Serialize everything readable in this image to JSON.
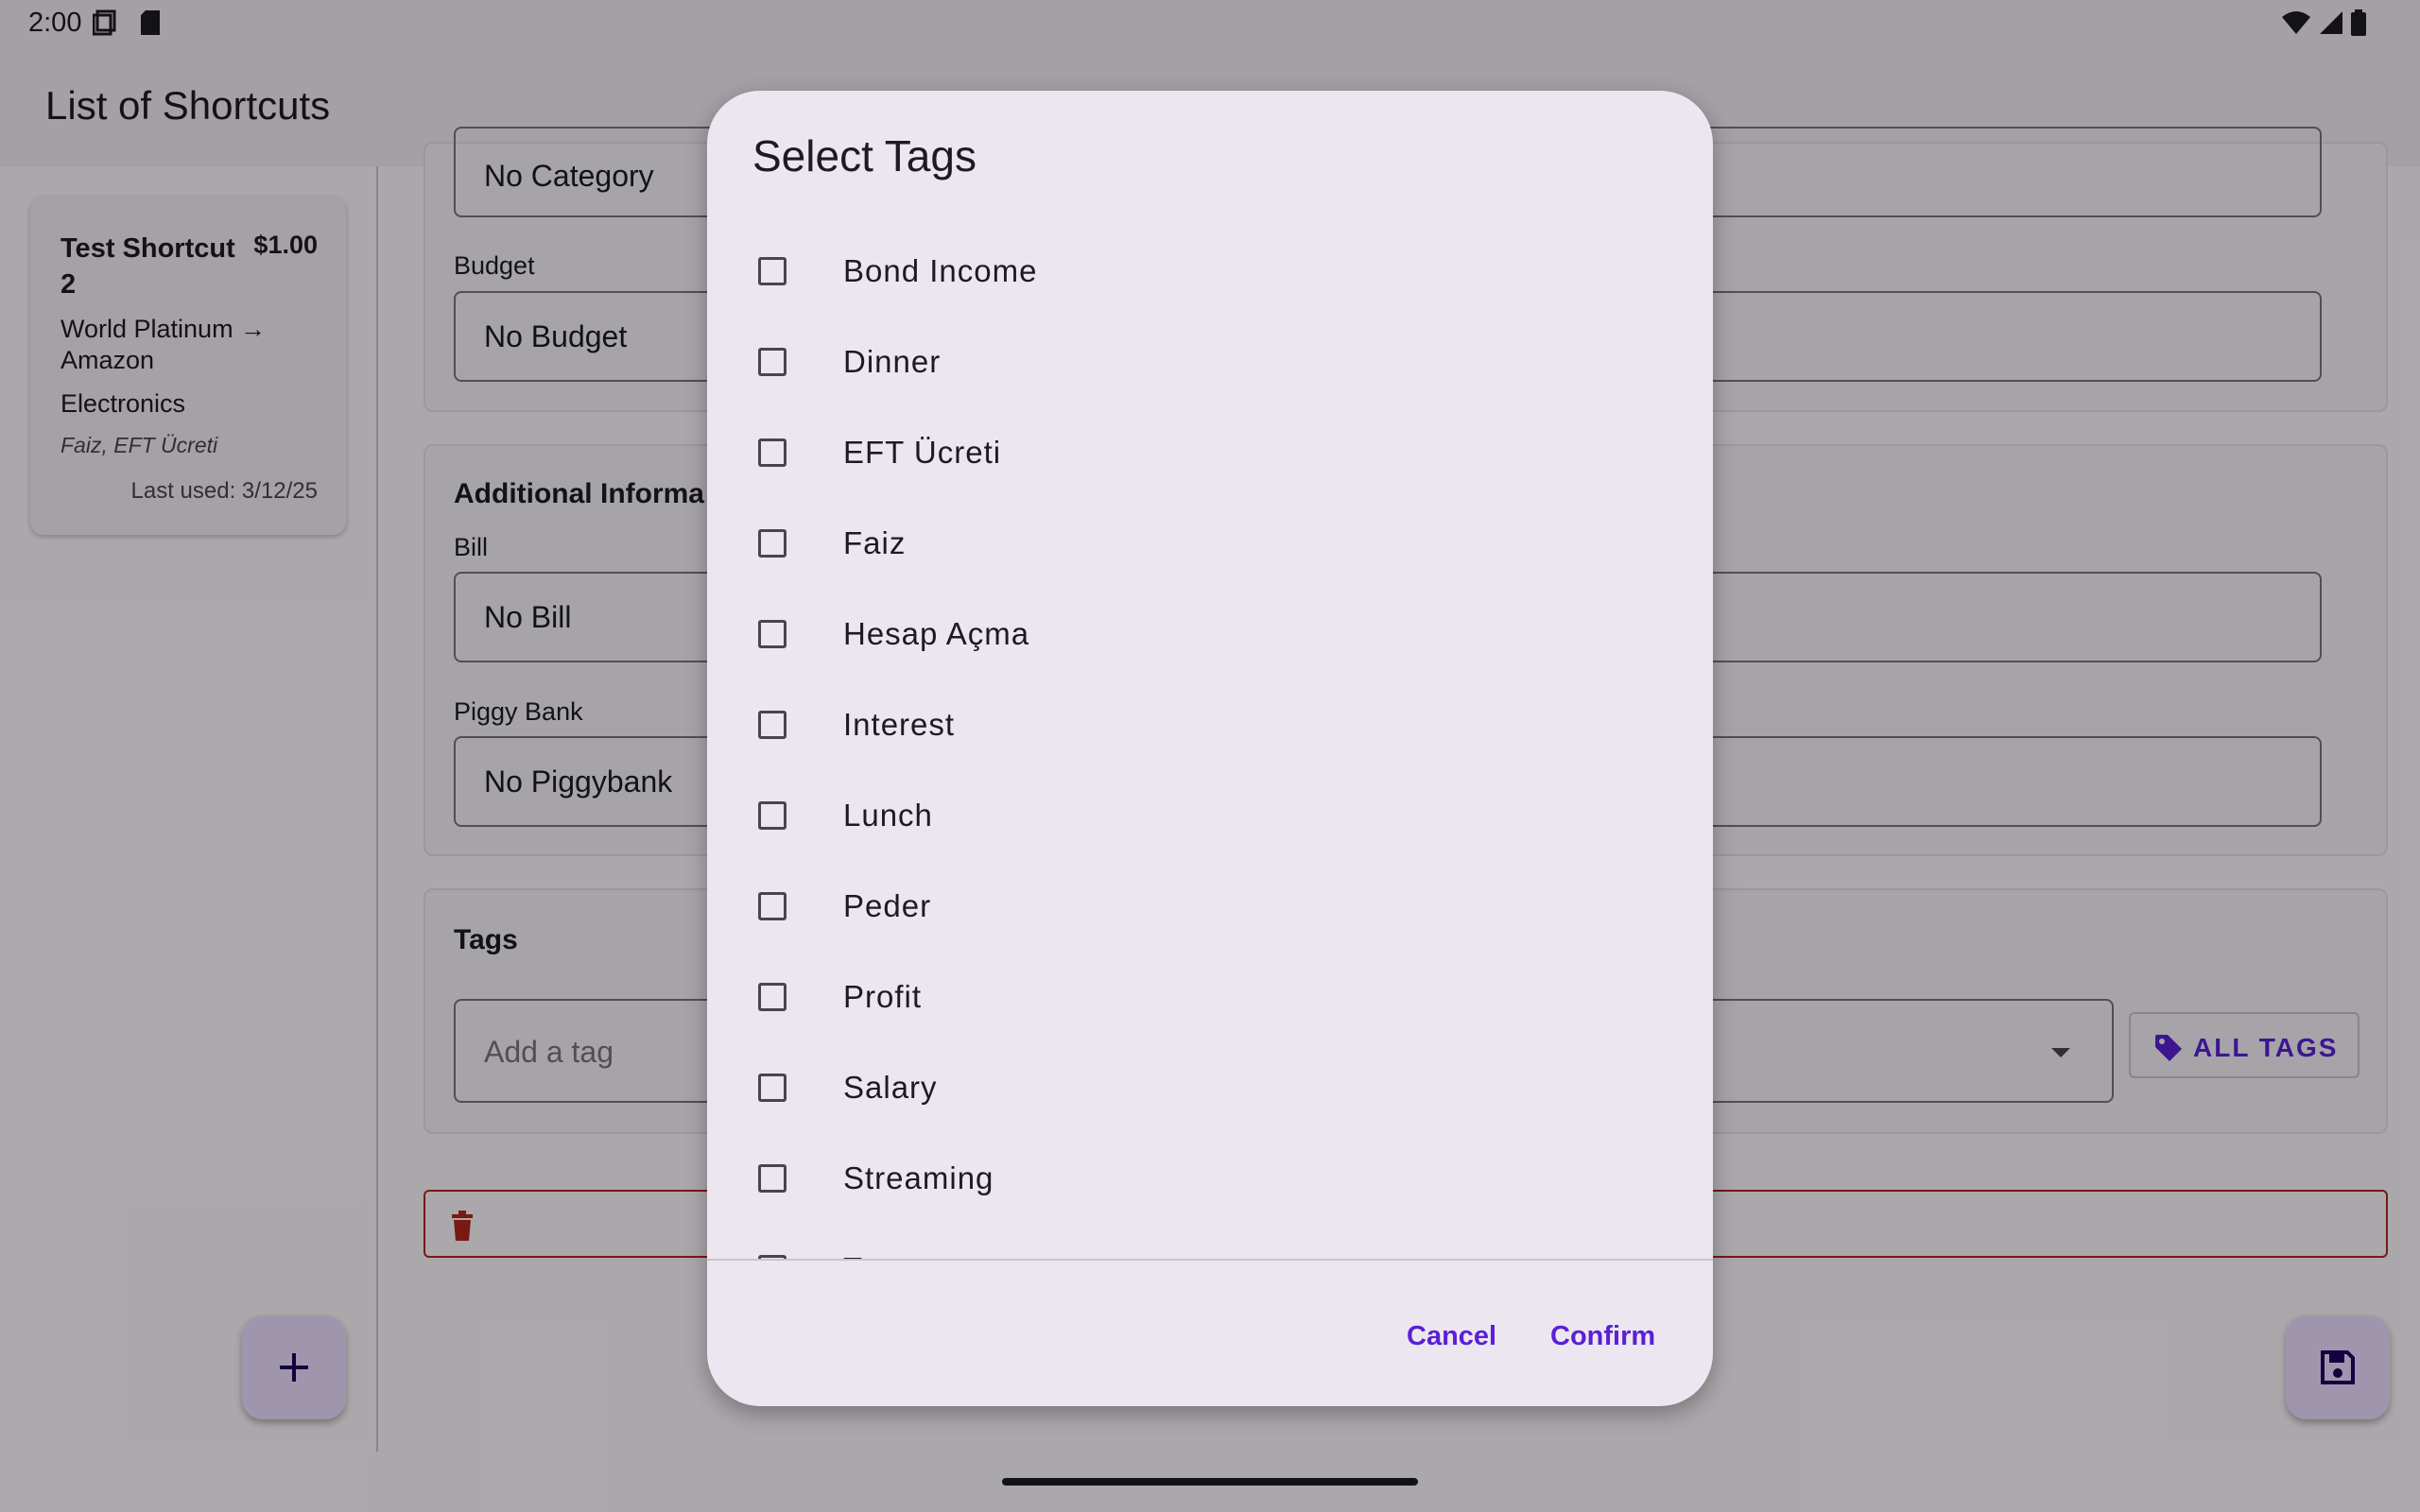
{
  "status_bar": {
    "time": "2:00"
  },
  "app_bar": {
    "title": "List of Shortcuts"
  },
  "shortcut_card": {
    "name": "Test Shortcut 2",
    "amount": "$1.00",
    "route": "World Platinum → Amazon",
    "category": "Electronics",
    "tags": "Faiz, EFT Ücreti",
    "last_used": "Last used: 3/12/25"
  },
  "form": {
    "category_value": "No Category",
    "budget_label": "Budget",
    "budget_value": "No Budget",
    "additional_title": "Additional Informa",
    "bill_label": "Bill",
    "bill_value": "No Bill",
    "piggy_label": "Piggy Bank",
    "piggy_value": "No Piggybank",
    "tags_title": "Tags",
    "tag_placeholder": "Add a tag",
    "all_tags_label": "ALL TAGS"
  },
  "dialog": {
    "title": "Select Tags",
    "options": [
      "Bond Income",
      "Dinner",
      "EFT Ücreti",
      "Faiz",
      "Hesap Açma",
      "Interest",
      "Lunch",
      "Peder",
      "Profit",
      "Salary",
      "Streaming",
      "Tax"
    ],
    "cancel_label": "Cancel",
    "confirm_label": "Confirm"
  },
  "colors": {
    "accent": "#5a1fd6",
    "danger": "#b3261e",
    "scrim": "rgba(0,0,0,0.32)"
  }
}
